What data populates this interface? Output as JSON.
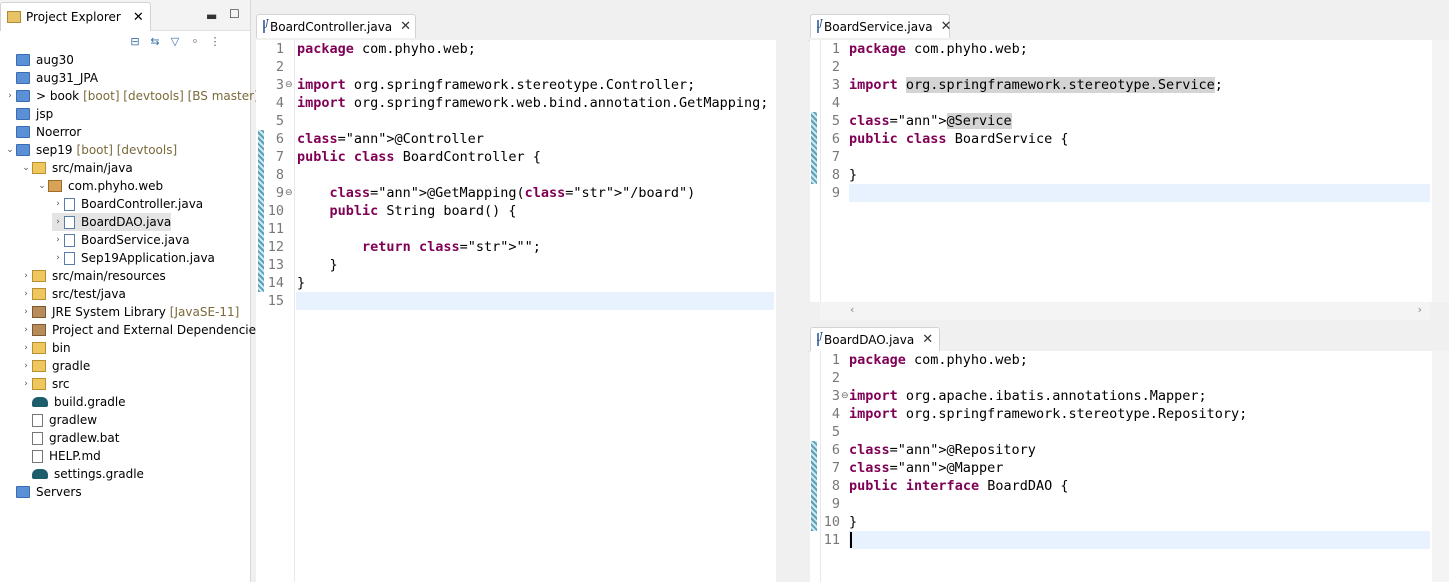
{
  "project_explorer": {
    "title": "Project Explorer",
    "tree": [
      {
        "label": "aug30",
        "suffix": "",
        "icon": "project-icon",
        "indent": 0,
        "arrow": ""
      },
      {
        "label": "aug31_JPA",
        "suffix": "",
        "icon": "project-icon",
        "indent": 0,
        "arrow": ""
      },
      {
        "label": "> book",
        "suffix": "[boot] [devtools] [BS master]",
        "icon": "project-icon",
        "indent": 0,
        "arrow": ">"
      },
      {
        "label": "jsp",
        "suffix": "",
        "icon": "project-icon",
        "indent": 0,
        "arrow": ""
      },
      {
        "label": "Noerror",
        "suffix": "",
        "icon": "project-icon",
        "indent": 0,
        "arrow": ""
      },
      {
        "label": "sep19",
        "suffix": "[boot] [devtools]",
        "icon": "project-icon",
        "indent": 0,
        "arrow": "v"
      },
      {
        "label": "src/main/java",
        "suffix": "",
        "icon": "source-folder-icon",
        "indent": 1,
        "arrow": "v"
      },
      {
        "label": "com.phyho.web",
        "suffix": "",
        "icon": "package-icon",
        "indent": 2,
        "arrow": "v"
      },
      {
        "label": "BoardController.java",
        "suffix": "",
        "icon": "java-file-icon",
        "indent": 3,
        "arrow": ">"
      },
      {
        "label": "BoardDAO.java",
        "suffix": "",
        "icon": "java-file-icon",
        "indent": 3,
        "arrow": ">",
        "selected": true
      },
      {
        "label": "BoardService.java",
        "suffix": "",
        "icon": "java-file-icon",
        "indent": 3,
        "arrow": ">"
      },
      {
        "label": "Sep19Application.java",
        "suffix": "",
        "icon": "java-file-icon",
        "indent": 3,
        "arrow": ">"
      },
      {
        "label": "src/main/resources",
        "suffix": "",
        "icon": "source-folder-icon",
        "indent": 1,
        "arrow": ">"
      },
      {
        "label": "src/test/java",
        "suffix": "",
        "icon": "source-folder-icon",
        "indent": 1,
        "arrow": ">"
      },
      {
        "label": "JRE System Library",
        "suffix": "[JavaSE-11]",
        "icon": "library-icon",
        "indent": 1,
        "arrow": ">"
      },
      {
        "label": "Project and External Dependencies",
        "suffix": "",
        "icon": "library-icon",
        "indent": 1,
        "arrow": ">"
      },
      {
        "label": "bin",
        "suffix": "",
        "icon": "folder-icon",
        "indent": 1,
        "arrow": ">"
      },
      {
        "label": "gradle",
        "suffix": "",
        "icon": "folder-icon",
        "indent": 1,
        "arrow": ">"
      },
      {
        "label": "src",
        "suffix": "",
        "icon": "folder-icon",
        "indent": 1,
        "arrow": ">"
      },
      {
        "label": "build.gradle",
        "suffix": "",
        "icon": "gradle-icon",
        "indent": 1,
        "arrow": ""
      },
      {
        "label": "gradlew",
        "suffix": "",
        "icon": "file-icon",
        "indent": 1,
        "arrow": ""
      },
      {
        "label": "gradlew.bat",
        "suffix": "",
        "icon": "file-icon",
        "indent": 1,
        "arrow": ""
      },
      {
        "label": "HELP.md",
        "suffix": "",
        "icon": "file-icon",
        "indent": 1,
        "arrow": ""
      },
      {
        "label": "settings.gradle",
        "suffix": "",
        "icon": "gradle-icon",
        "indent": 1,
        "arrow": ""
      },
      {
        "label": "Servers",
        "suffix": "",
        "icon": "project-icon",
        "indent": 0,
        "arrow": ""
      }
    ]
  },
  "editors": {
    "controller": {
      "tab": "BoardController.java",
      "lines": [
        "package com.phyho.web;",
        "",
        "import org.springframework.stereotype.Controller;",
        "import org.springframework.web.bind.annotation.GetMapping;",
        "",
        "@Controller",
        "public class BoardController {",
        "",
        "    @GetMapping(\"/board\")",
        "    public String board() {",
        "",
        "        return \"\";",
        "    }",
        "}",
        ""
      ]
    },
    "service": {
      "tab": "BoardService.java",
      "lines": [
        "package com.phyho.web;",
        "",
        "import org.springframework.stereotype.Service;",
        "",
        "@Service",
        "public class BoardService {",
        "",
        "}",
        ""
      ]
    },
    "dao": {
      "tab": "BoardDAO.java",
      "lines": [
        "package com.phyho.web;",
        "",
        "import org.apache.ibatis.annotations.Mapper;",
        "import org.springframework.stereotype.Repository;",
        "",
        "@Repository",
        "@Mapper",
        "public interface BoardDAO {",
        "",
        "}",
        ""
      ]
    }
  }
}
